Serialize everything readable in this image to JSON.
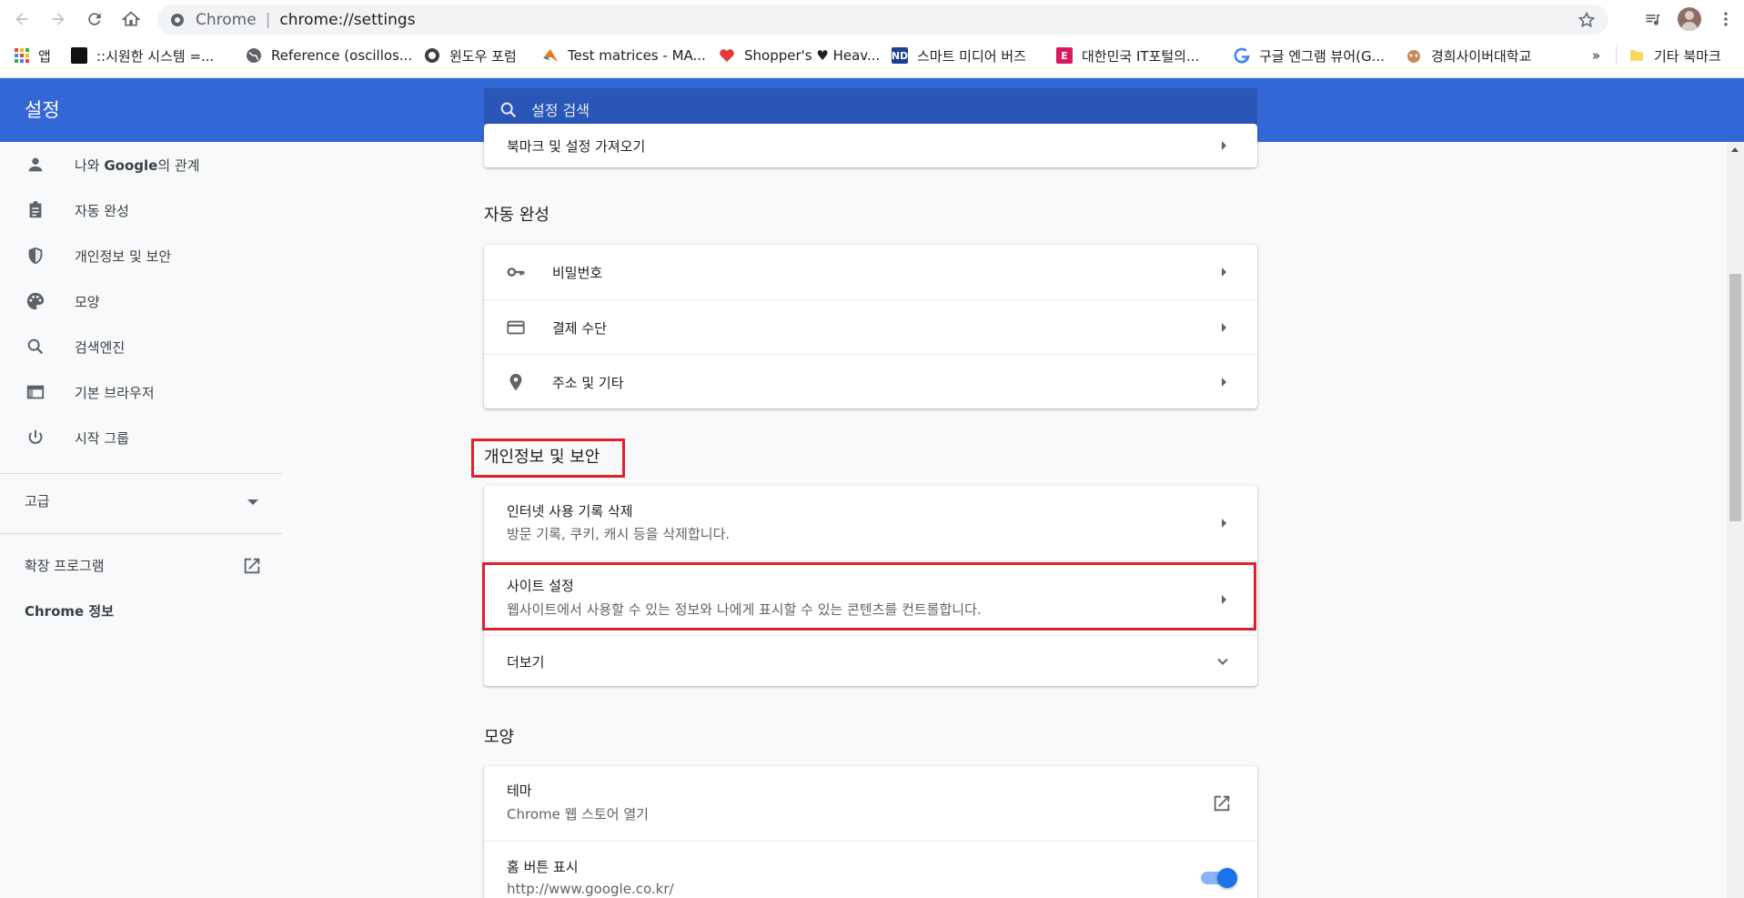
{
  "browser": {
    "omnibox_chip": "Chrome",
    "omnibox_divider": "|",
    "url": "chrome://settings"
  },
  "bookmarks": [
    {
      "label": "앱",
      "icon": "apps-grid-icon"
    },
    {
      "label": "::시원한 시스템 =...",
      "icon": "site-favicon",
      "color": "#111111"
    },
    {
      "label": "Reference (oscillos...",
      "icon": "globe-icon",
      "color": "#5f6368"
    },
    {
      "label": "윈도우 포럼",
      "icon": "site-favicon",
      "color": "#3c4043"
    },
    {
      "label": "Test matrices - MA...",
      "icon": "matlab-icon",
      "color": "#e87722"
    },
    {
      "label": "Shopper's ♥ Heav...",
      "icon": "heart-icon",
      "color": "#e53935"
    },
    {
      "label": "스마트 미디어 버즈",
      "icon": "site-favicon",
      "color": "#1c3f94"
    },
    {
      "label": "대한민국 IT포털의...",
      "icon": "site-favicon",
      "color": "#d81b60"
    },
    {
      "label": "구글 엔그램 뷰어(G...",
      "icon": "google-icon",
      "color": "#4285f4"
    },
    {
      "label": "경희사이버대학교",
      "icon": "site-favicon",
      "color": "#8d6e63"
    }
  ],
  "bookmarks_overflow": "»",
  "other_bookmarks": "기타 북마크",
  "settings": {
    "title": "설정",
    "search_placeholder": "설정 검색"
  },
  "sidebar": {
    "items": [
      {
        "label_prefix": "나와 ",
        "label_bold": "Google",
        "label_suffix": "의 관계",
        "icon": "person-icon"
      },
      {
        "label": "자동 완성",
        "icon": "clipboard-icon"
      },
      {
        "label": "개인정보 및 보안",
        "icon": "shield-icon"
      },
      {
        "label": "모양",
        "icon": "palette-icon"
      },
      {
        "label": "검색엔진",
        "icon": "search-icon"
      },
      {
        "label": "기본 브라우저",
        "icon": "browser-icon"
      },
      {
        "label": "시작 그룹",
        "icon": "power-icon"
      }
    ],
    "advanced": "고급",
    "extensions": "확장 프로그램",
    "about": "Chrome 정보"
  },
  "main": {
    "partial_row": "북마크 및 설정 가져오기",
    "autofill": {
      "title": "자동 완성",
      "rows": [
        {
          "label": "비밀번호",
          "icon": "key-icon"
        },
        {
          "label": "결제 수단",
          "icon": "credit-card-icon"
        },
        {
          "label": "주소 및 기타",
          "icon": "location-pin-icon"
        }
      ]
    },
    "privacy": {
      "title": "개인정보 및 보안",
      "rows": [
        {
          "label": "인터넷 사용 기록 삭제",
          "sub": "방문 기록, 쿠키, 캐시 등을 삭제합니다."
        },
        {
          "label": "사이트 설정",
          "sub": "웹사이트에서 사용할 수 있는 정보와 나에게 표시할 수 있는 콘텐츠를 컨트롤합니다."
        }
      ],
      "more": "더보기"
    },
    "appearance": {
      "title": "모양",
      "theme_label": "테마",
      "theme_sub": "Chrome 웹 스토어 열기",
      "home_label": "홈 버튼 표시",
      "home_sub": "http://www.google.co.kr/",
      "home_enabled": true
    }
  },
  "colors": {
    "header": "#3367d6",
    "search": "#2a56b7",
    "highlight": "#e0202a",
    "toggle": "#1a73e8"
  }
}
